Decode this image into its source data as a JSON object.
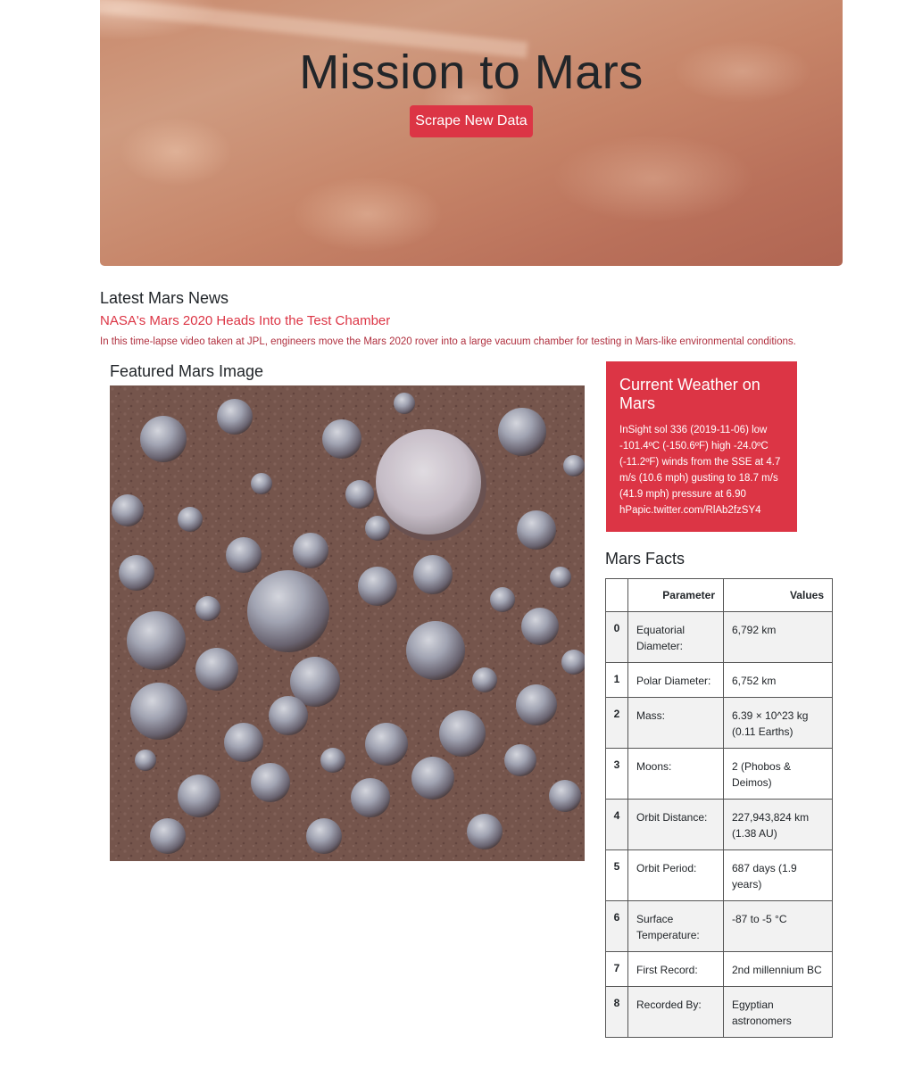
{
  "hero": {
    "title": "Mission to Mars",
    "button_label": "Scrape New Data"
  },
  "news": {
    "heading": "Latest Mars News",
    "title": "NASA's Mars 2020 Heads Into the Test Chamber",
    "paragraph": "In this time-lapse video taken at JPL, engineers move the Mars 2020 rover into a large vacuum chamber for testing in Mars-like environmental conditions."
  },
  "featured_image": {
    "heading": "Featured Mars Image"
  },
  "weather": {
    "heading": "Current Weather on Mars",
    "text": "InSight sol 336 (2019-11-06) low -101.4ºC (-150.6ºF) high -24.0ºC (-11.2ºF) winds from the SSE at 4.7 m/s (10.6 mph) gusting to 18.7 m/s (41.9 mph) pressure at 6.90 hPapic.twitter.com/RlAb2fzSY4"
  },
  "facts": {
    "heading": "Mars Facts",
    "columns": [
      "",
      "Parameter",
      "Values"
    ],
    "rows": [
      {
        "index": "0",
        "parameter": "Equatorial Diameter:",
        "value": "6,792 km"
      },
      {
        "index": "1",
        "parameter": "Polar Diameter:",
        "value": "6,752 km"
      },
      {
        "index": "2",
        "parameter": "Mass:",
        "value": "6.39 × 10^23 kg (0.11 Earths)"
      },
      {
        "index": "3",
        "parameter": "Moons:",
        "value": "2 (Phobos & Deimos)"
      },
      {
        "index": "4",
        "parameter": "Orbit Distance:",
        "value": "227,943,824 km (1.38 AU)"
      },
      {
        "index": "5",
        "parameter": "Orbit Period:",
        "value": "687 days (1.9 years)"
      },
      {
        "index": "6",
        "parameter": "Surface Temperature:",
        "value": "-87 to -5 °C"
      },
      {
        "index": "7",
        "parameter": "First Record:",
        "value": "2nd millennium BC"
      },
      {
        "index": "8",
        "parameter": "Recorded By:",
        "value": "Egyptian astronomers"
      }
    ]
  },
  "colors": {
    "accent": "#dc3545",
    "news_paragraph": "#b0303f",
    "text": "#212529"
  }
}
